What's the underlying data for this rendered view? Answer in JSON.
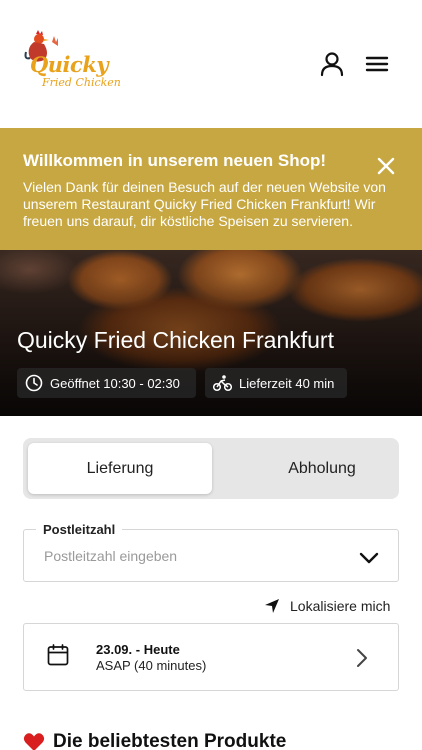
{
  "header": {
    "logo_line1": "Quicky",
    "logo_line2": "Fried Chicken"
  },
  "icons": {
    "account": "user-icon",
    "menu": "hamburger-menu-icon",
    "close": "close-icon",
    "clock": "clock-icon",
    "bike": "bike-icon",
    "chevron": "chevron-down-icon",
    "locate": "location-arrow-icon",
    "calendar": "calendar-icon",
    "next": "chevron-right-icon",
    "heart": "heart-icon"
  },
  "banner": {
    "title": "Willkommen in unserem neuen Shop!",
    "text": "Vielen Dank für deinen Besuch auf der neuen Website von unserem Restaurant Quicky Fried Chicken Frankfurt! Wir freuen uns darauf, dir köstliche Speisen zu servieren."
  },
  "hero": {
    "restaurant_name": "Quicky Fried Chicken Frankfurt",
    "opening_hours": "Geöffnet 10:30 - 02:30",
    "delivery_time": "Lieferzeit 40 min"
  },
  "order_type": {
    "options": [
      "Lieferung",
      "Abholung"
    ],
    "selected": "Lieferung"
  },
  "postcode": {
    "label": "Postleitzahl",
    "placeholder": "Postleitzahl eingeben",
    "value": ""
  },
  "locate_label": "Lokalisiere mich",
  "schedule": {
    "date": "23.09. - Heute",
    "time": "ASAP (40 minutes)"
  },
  "popular_title": "Die beliebtesten Produkte",
  "colors": {
    "banner": "#c7a741",
    "logo": "#e8a21b",
    "heart": "#d81e1e"
  }
}
